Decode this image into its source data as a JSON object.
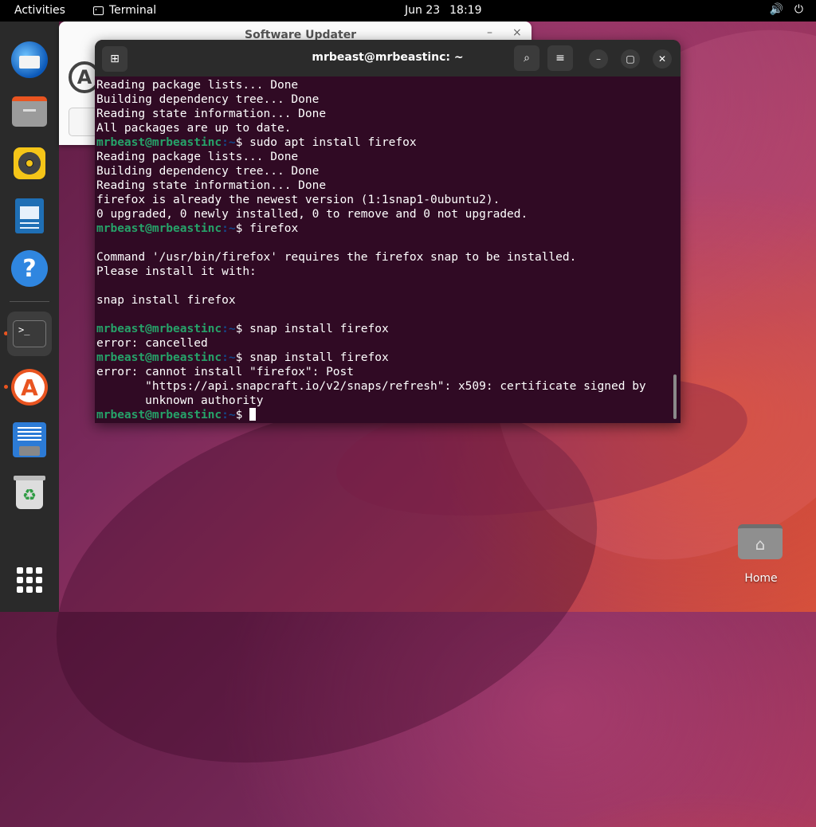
{
  "topbar": {
    "activities": "Activities",
    "app_name": "Terminal",
    "date": "Jun 23",
    "time": "18:19",
    "volume_icon": "🔊",
    "power_icon": "⏻"
  },
  "dock": {
    "items": [
      {
        "name": "Thunderbird Mail",
        "icon": "thunderbird-icon"
      },
      {
        "name": "Files",
        "icon": "files-icon"
      },
      {
        "name": "Rhythmbox",
        "icon": "rhythmbox-icon"
      },
      {
        "name": "LibreOffice Writer",
        "icon": "writer-icon"
      },
      {
        "name": "Help",
        "icon": "help-icon",
        "glyph": "?"
      },
      {
        "name": "Terminal",
        "icon": "terminal-icon",
        "glyph": ">_",
        "active": true
      },
      {
        "name": "Ubuntu Software",
        "icon": "software-store-icon",
        "glyph": "A"
      },
      {
        "name": "Text Editor",
        "icon": "text-editor-icon"
      },
      {
        "name": "Trash",
        "icon": "trash-icon",
        "glyph": "♻"
      },
      {
        "name": "Show Applications",
        "icon": "app-grid-icon"
      }
    ]
  },
  "updater": {
    "title": "Software Updater",
    "minimize": "–",
    "close": "×",
    "logo": "A"
  },
  "terminal": {
    "title": "mrbeast@mrbeastinc: ~",
    "new_tab_glyph": "⊞",
    "search_glyph": "⌕",
    "menu_glyph": "≡",
    "minimize_glyph": "–",
    "maximize_glyph": "▢",
    "close_glyph": "✕",
    "prompt_user": "mrbeast@mrbeastinc",
    "prompt_path": ":~",
    "prompt_symbol": "$ ",
    "lines": [
      {
        "text": "Reading package lists... Done"
      },
      {
        "text": "Building dependency tree... Done"
      },
      {
        "text": "Reading state information... Done"
      },
      {
        "text": "All packages are up to date."
      },
      {
        "prompt": true,
        "cmd": "sudo apt install firefox"
      },
      {
        "text": "Reading package lists... Done"
      },
      {
        "text": "Building dependency tree... Done"
      },
      {
        "text": "Reading state information... Done"
      },
      {
        "text": "firefox is already the newest version (1:1snap1-0ubuntu2)."
      },
      {
        "text": "0 upgraded, 0 newly installed, 0 to remove and 0 not upgraded."
      },
      {
        "prompt": true,
        "cmd": "firefox"
      },
      {
        "text": ""
      },
      {
        "text": "Command '/usr/bin/firefox' requires the firefox snap to be installed."
      },
      {
        "text": "Please install it with:"
      },
      {
        "text": ""
      },
      {
        "text": "snap install firefox"
      },
      {
        "text": ""
      },
      {
        "prompt": true,
        "cmd": "snap install firefox"
      },
      {
        "text": "error: cancelled"
      },
      {
        "prompt": true,
        "cmd": "snap install firefox"
      },
      {
        "text": "error: cannot install \"firefox\": Post"
      },
      {
        "text": "       \"https://api.snapcraft.io/v2/snaps/refresh\": x509: certificate signed by"
      },
      {
        "text": "       unknown authority"
      },
      {
        "prompt": true,
        "cmd": "",
        "cursor": true
      }
    ]
  },
  "desktop": {
    "home_label": "Home",
    "home_glyph": "⌂"
  }
}
